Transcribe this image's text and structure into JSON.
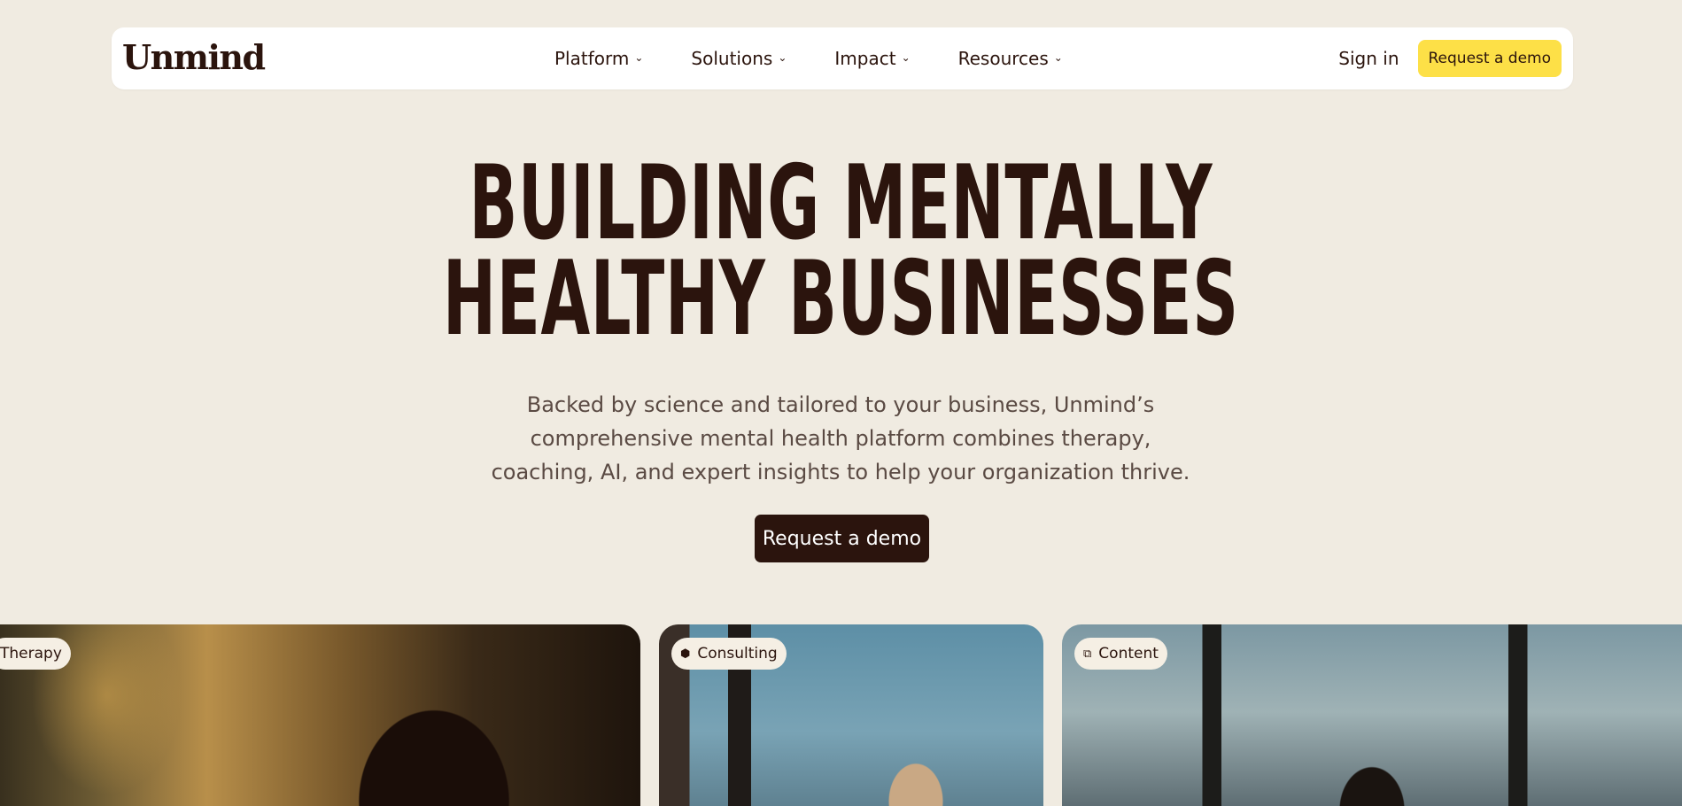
{
  "brand": {
    "logo_text": "Unmind"
  },
  "nav": {
    "items": [
      {
        "label": "Platform",
        "icon": "chevron-down-icon"
      },
      {
        "label": "Solutions",
        "icon": "chevron-down-icon"
      },
      {
        "label": "Impact",
        "icon": "chevron-down-icon"
      },
      {
        "label": "Resources",
        "icon": "chevron-down-icon"
      }
    ],
    "sign_in": "Sign in",
    "cta": "Request a demo"
  },
  "hero": {
    "title_line1": "BUILDING MENTALLY",
    "title_line2": "HEALTHY BUSINESSES",
    "subtitle": "Backed by science and tailored to your business, Unmind’s comprehensive mental health platform combines therapy, coaching, AI, and expert insights to help your organization thrive.",
    "cta": "Request a demo"
  },
  "cards": [
    {
      "tag": "Therapy",
      "icon": "therapy-icon"
    },
    {
      "tag": "Consulting",
      "icon": "consulting-icon"
    },
    {
      "tag": "Content",
      "icon": "content-icon"
    }
  ],
  "colors": {
    "background": "#f0ebe1",
    "text": "#2b140d",
    "accent_yellow": "#fde047",
    "cta_dark": "#2b140d"
  }
}
